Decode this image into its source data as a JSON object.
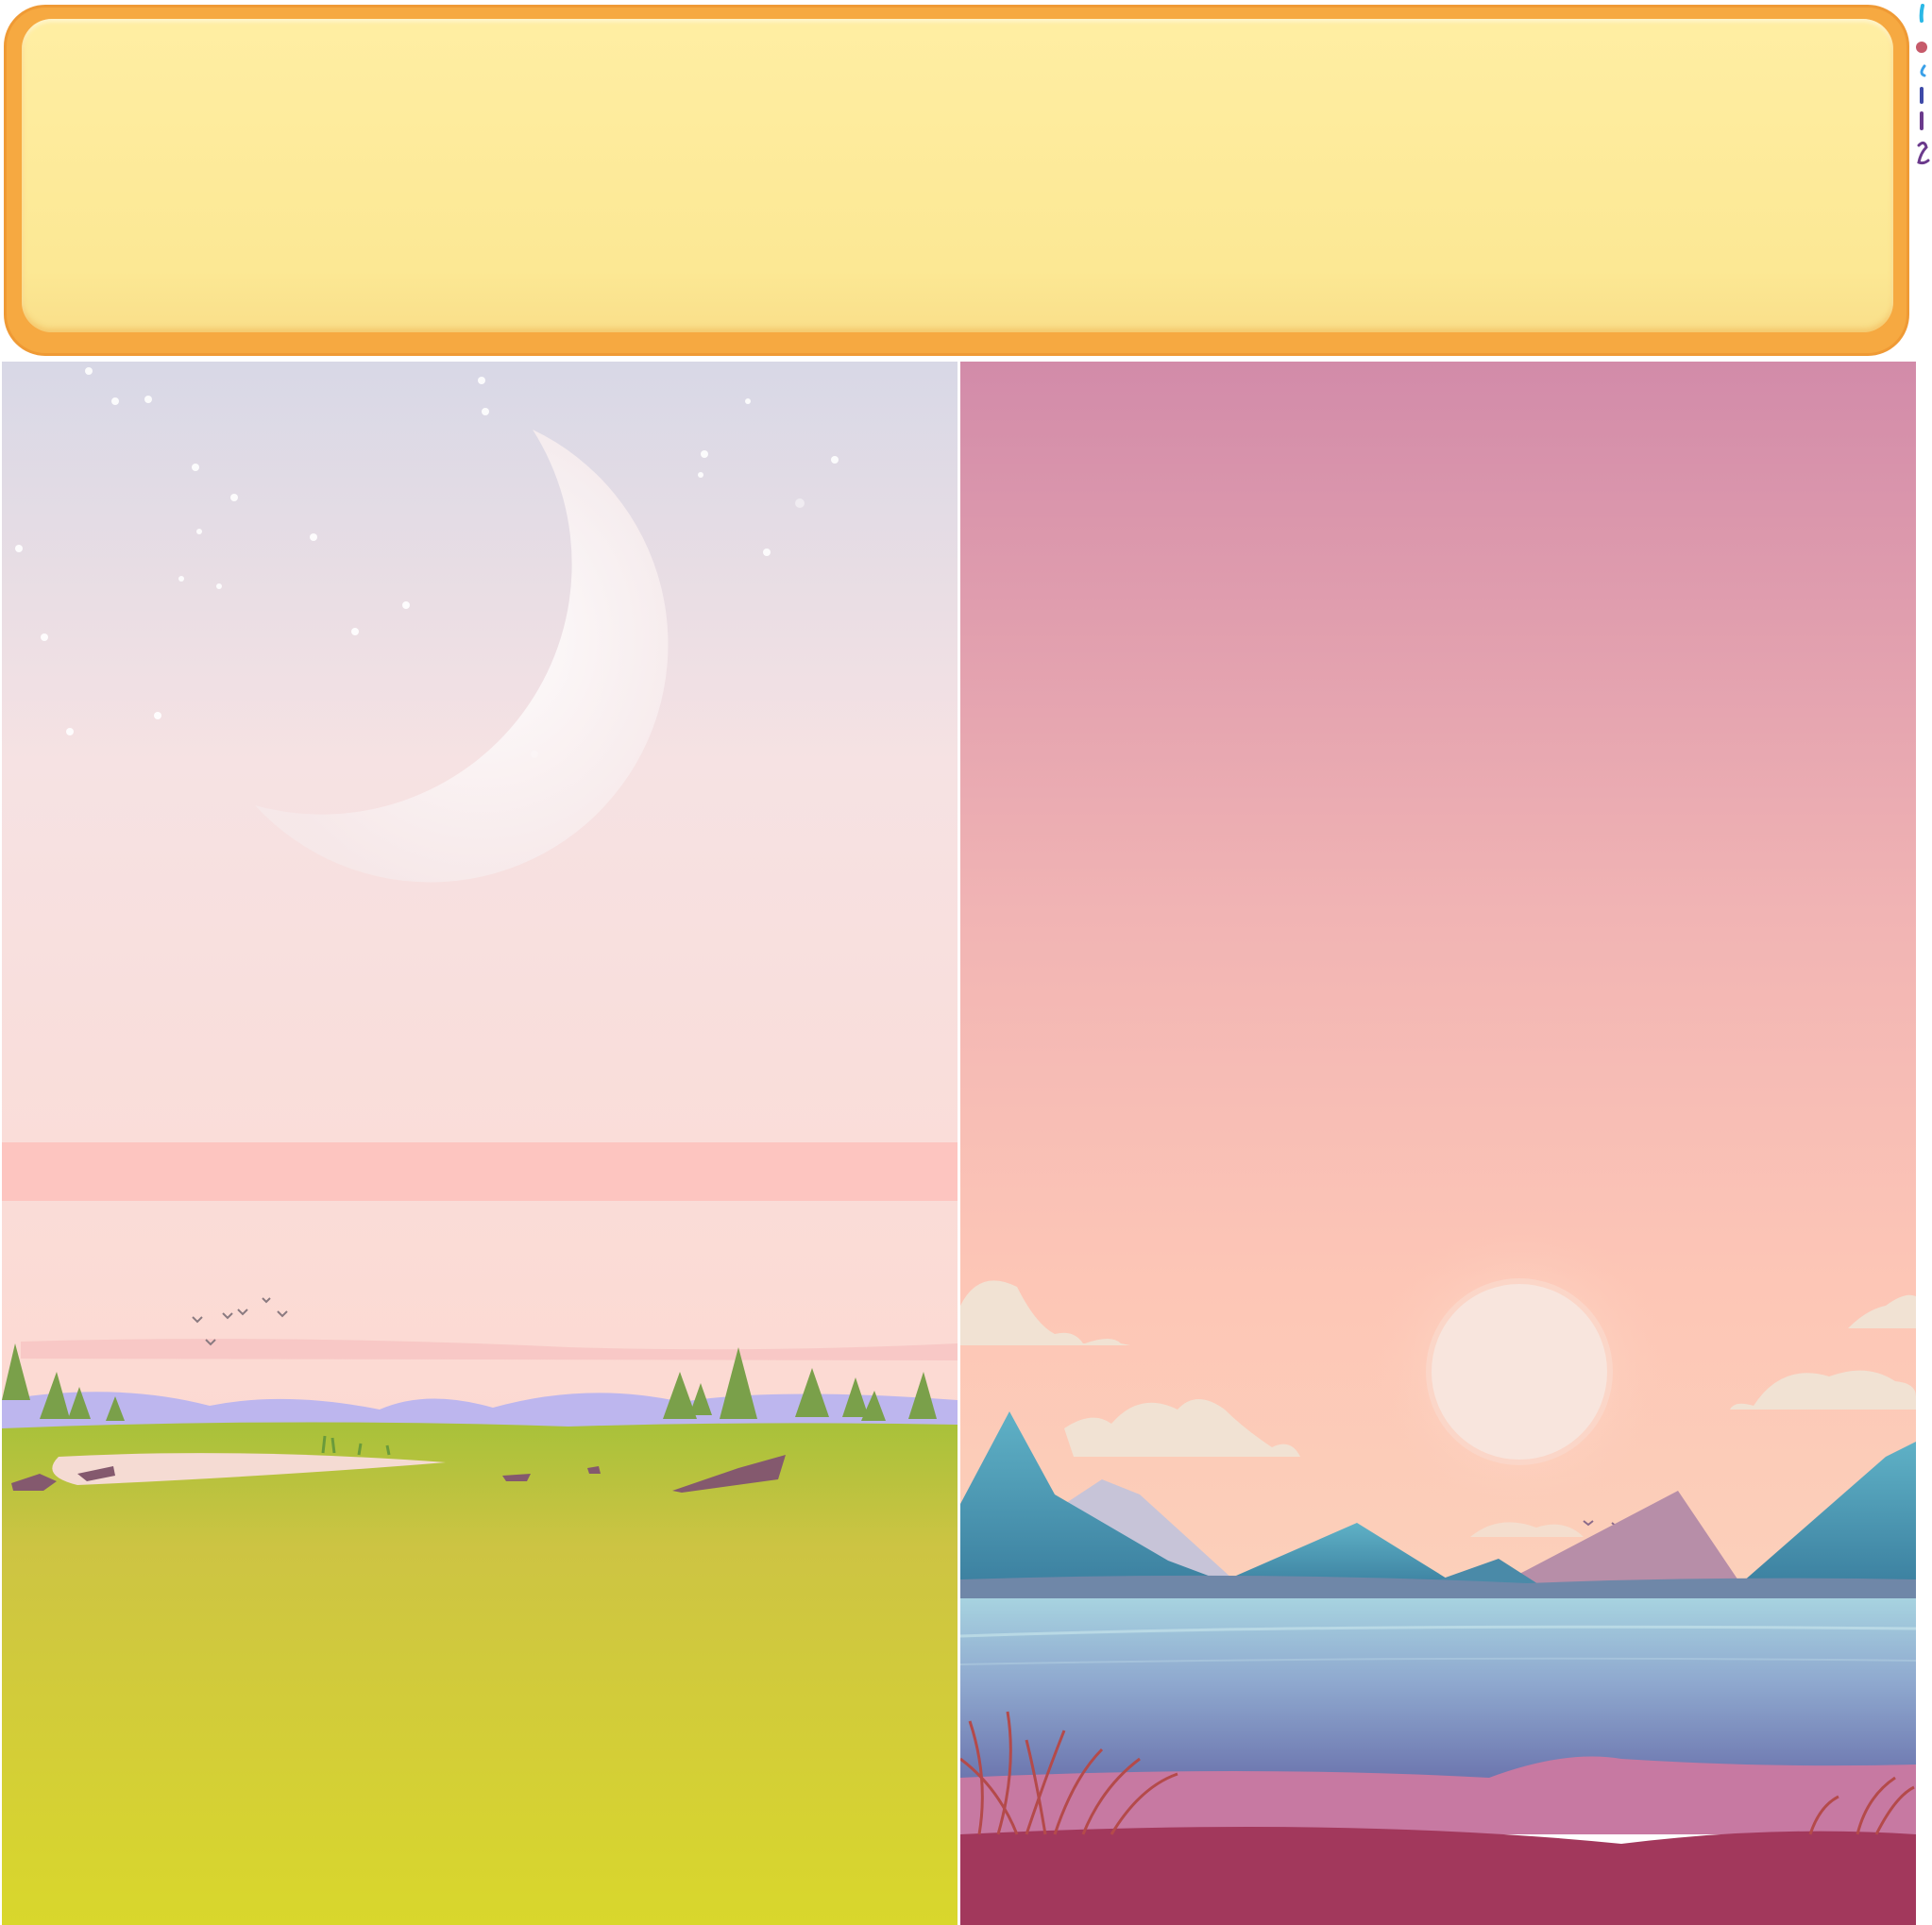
{
  "banner": {
    "text": "",
    "fill_color": "#fde995",
    "border_color": "#f2a53c"
  },
  "sprite_strip": {
    "icons": [
      "cyan-stroke-icon",
      "red-dot-icon",
      "blue-droplet-icon",
      "blue-bar-icon",
      "purple-bar-icon",
      "purple-squiggle-icon"
    ]
  },
  "panels": [
    {
      "name": "moonlit-meadow",
      "sky_top": "#d8d8e6",
      "sky_bottom": "#fbd6d0",
      "ground": "#d6d52d"
    },
    {
      "name": "sunset-lake-mountains",
      "sky_top": "#d28ba9",
      "sky_bottom": "#fdcbb8",
      "water": "#6f78ad",
      "shore": "#a2385c"
    }
  ]
}
